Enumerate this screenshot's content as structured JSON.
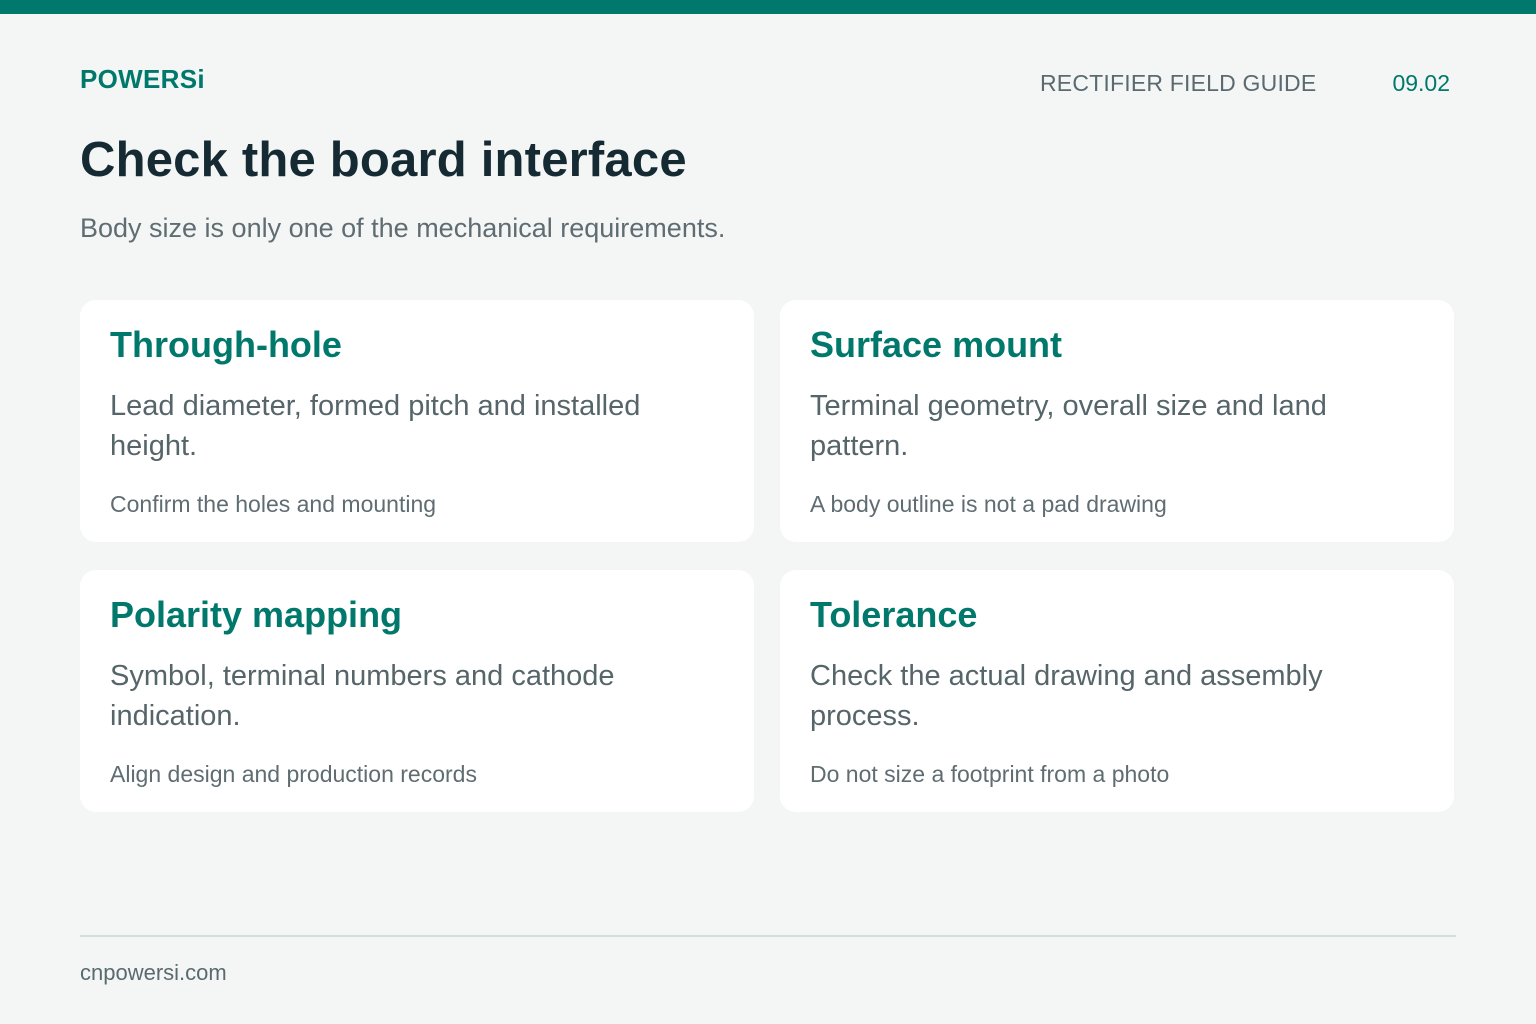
{
  "header": {
    "brand": "POWERSi",
    "guide_label": "RECTIFIER FIELD GUIDE",
    "page_number": "09.02"
  },
  "main": {
    "title": "Check the board interface",
    "subtitle": "Body size is only one of the mechanical requirements."
  },
  "cards": [
    {
      "title": "Through-hole",
      "body": "Lead diameter, formed pitch and installed height.",
      "note": "Confirm the holes and mounting"
    },
    {
      "title": "Surface mount",
      "body": "Terminal geometry, overall size and land pattern.",
      "note": "A body outline is not a pad drawing"
    },
    {
      "title": "Polarity mapping",
      "body": "Symbol, terminal numbers and cathode indication.",
      "note": "Align design and production records"
    },
    {
      "title": "Tolerance",
      "body": "Check the actual drawing and assembly process.",
      "note": "Do not size a footprint from a photo"
    }
  ],
  "footer": {
    "url": "cnpowersi.com"
  },
  "colors": {
    "accent": "#00786b",
    "background": "#f4f6f5",
    "title_text": "#152a33",
    "muted_text": "#5f6d73",
    "card_background": "#ffffff"
  }
}
